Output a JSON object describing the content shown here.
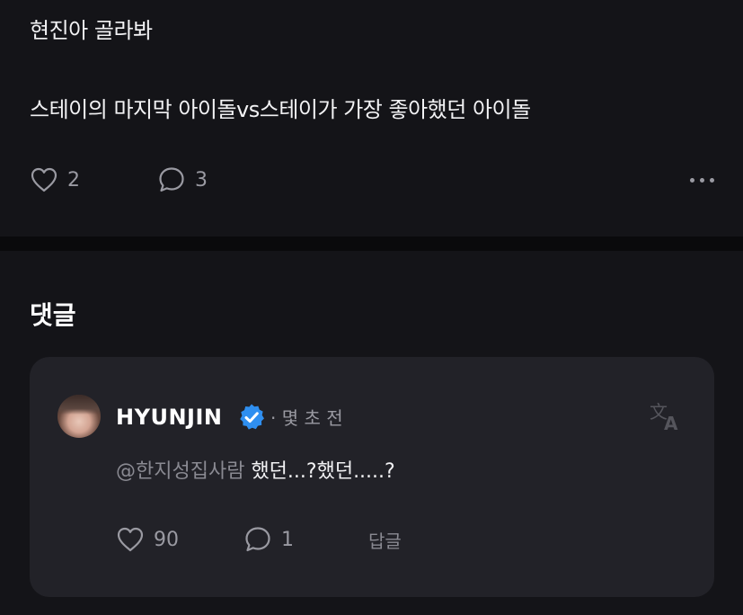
{
  "post": {
    "line1": "현진아 골라봐",
    "line2": "스테이의 마지막 아이돌vs스테이가 가장 좋아했던 아이돌",
    "likes": "2",
    "comments": "3",
    "icons": [
      "heart-icon",
      "comment-icon",
      "more-icon"
    ]
  },
  "comments_section": {
    "title": "댓글"
  },
  "comment": {
    "username": "HYUNJIN",
    "meta": "· 몇 초 전",
    "mention": "@한지성집사람",
    "text": " 했던...?했던.....?",
    "likes": "90",
    "replies_count": "1",
    "reply_label": "답글",
    "colors": {
      "verified": "#2f8ff0",
      "card": "#222228",
      "muted": "#9a9aa2"
    },
    "icons": [
      "avatar",
      "verified-badge-icon",
      "translate-icon",
      "heart-icon",
      "comment-icon"
    ]
  }
}
